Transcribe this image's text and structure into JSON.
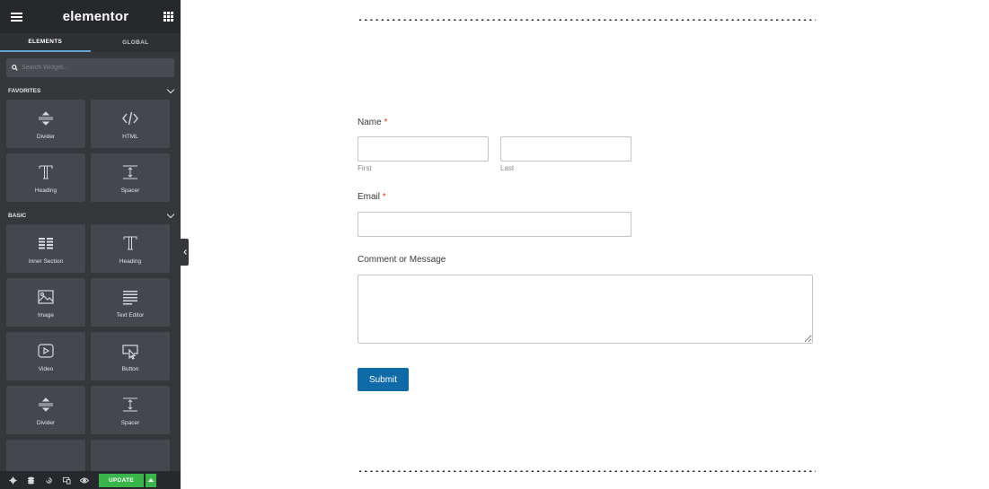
{
  "app": {
    "logo": "elementor"
  },
  "tabs": [
    {
      "label": "ELEMENTS",
      "active": true
    },
    {
      "label": "GLOBAL",
      "active": false
    }
  ],
  "search": {
    "placeholder": "Search Widget...",
    "value": ""
  },
  "categories": {
    "favorites": {
      "title": "FAVORITES",
      "widgets": [
        {
          "label": "Divider",
          "icon": "divider-icon"
        },
        {
          "label": "HTML",
          "icon": "html-icon"
        },
        {
          "label": "Heading",
          "icon": "heading-icon"
        },
        {
          "label": "Spacer",
          "icon": "spacer-icon"
        }
      ]
    },
    "basic": {
      "title": "BASIC",
      "widgets": [
        {
          "label": "Inner Section",
          "icon": "inner-section-icon"
        },
        {
          "label": "Heading",
          "icon": "heading-icon"
        },
        {
          "label": "Image",
          "icon": "image-icon"
        },
        {
          "label": "Text Editor",
          "icon": "text-editor-icon"
        },
        {
          "label": "Video",
          "icon": "video-icon"
        },
        {
          "label": "Button",
          "icon": "button-icon"
        },
        {
          "label": "Divider",
          "icon": "divider-icon"
        },
        {
          "label": "Spacer",
          "icon": "spacer-icon"
        }
      ]
    }
  },
  "bottom_bar": {
    "update_label": "UPDATE"
  },
  "form": {
    "name_label": "Name",
    "required_mark": "*",
    "first_sublabel": "First",
    "last_sublabel": "Last",
    "email_label": "Email",
    "comment_label": "Comment or Message",
    "submit_label": "Submit"
  },
  "colors": {
    "sidebar_bg": "#35373b",
    "widget_bg": "#44474c",
    "tab_active_underline": "#5fa5d8",
    "update_green": "#39b54a",
    "submit_blue": "#0e6ba8",
    "required_red": "#e2401c"
  }
}
